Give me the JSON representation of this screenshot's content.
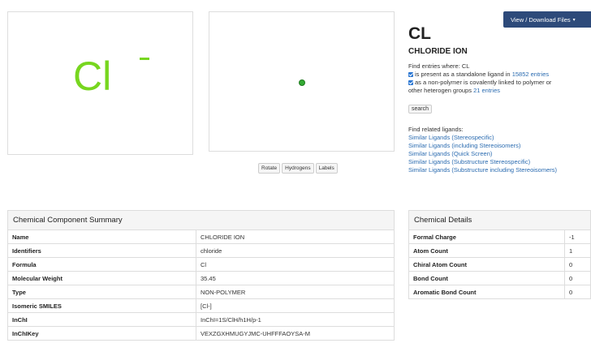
{
  "structure": {
    "formula_text": "Cl",
    "charge_text": "−"
  },
  "viewer": {
    "buttons": [
      "Rotate",
      "Hydrogens",
      "Labels"
    ]
  },
  "header": {
    "download_button": "View / Download Files",
    "id": "CL",
    "name": "CHLORIDE ION"
  },
  "find_entries": {
    "label": "Find entries where: CL",
    "option1_text": "is present as a standalone ligand in",
    "option1_link": "15852 entries",
    "option2_line1": "as a non-polymer is covalently linked to polymer or",
    "option2_line2": "other heterogen groups",
    "option2_link": "21 entries",
    "search_button": "search"
  },
  "related": {
    "label": "Find related ligands:",
    "links": [
      "Similar Ligands (Stereospecific)",
      "Similar Ligands (including Stereoisomers)",
      "Similar Ligands (Quick Screen)",
      "Similar Ligands (Substructure Stereospecific)",
      "Similar Ligands (Substructure including Stereoisomers)"
    ]
  },
  "summary": {
    "title": "Chemical Component Summary",
    "rows": [
      {
        "key": "Name",
        "value": "CHLORIDE ION"
      },
      {
        "key": "Identifiers",
        "value": "chloride"
      },
      {
        "key": "Formula",
        "value": "Cl"
      },
      {
        "key": "Molecular Weight",
        "value": "35.45"
      },
      {
        "key": "Type",
        "value": "NON-POLYMER"
      },
      {
        "key": "Isomeric SMILES",
        "value": "[Cl-]"
      },
      {
        "key": "InChI",
        "value": "InChI=1S/ClH/h1H/p-1"
      },
      {
        "key": "InChIKey",
        "value": "VEXZGXHMUGYJMC-UHFFFAOYSA-M"
      }
    ]
  },
  "details": {
    "title": "Chemical Details",
    "rows": [
      {
        "key": "Formal Charge",
        "value": "-1"
      },
      {
        "key": "Atom Count",
        "value": "1"
      },
      {
        "key": "Chiral Atom Count",
        "value": "0"
      },
      {
        "key": "Bond Count",
        "value": "0"
      },
      {
        "key": "Aromatic Bond Count",
        "value": "0"
      }
    ]
  },
  "colors": {
    "structure_green": "#77d61f",
    "atom_green": "#33aa33",
    "link_blue": "#2a6bb0",
    "button_navy": "#2d4a7a",
    "checkbox_blue": "#2a76d2"
  }
}
